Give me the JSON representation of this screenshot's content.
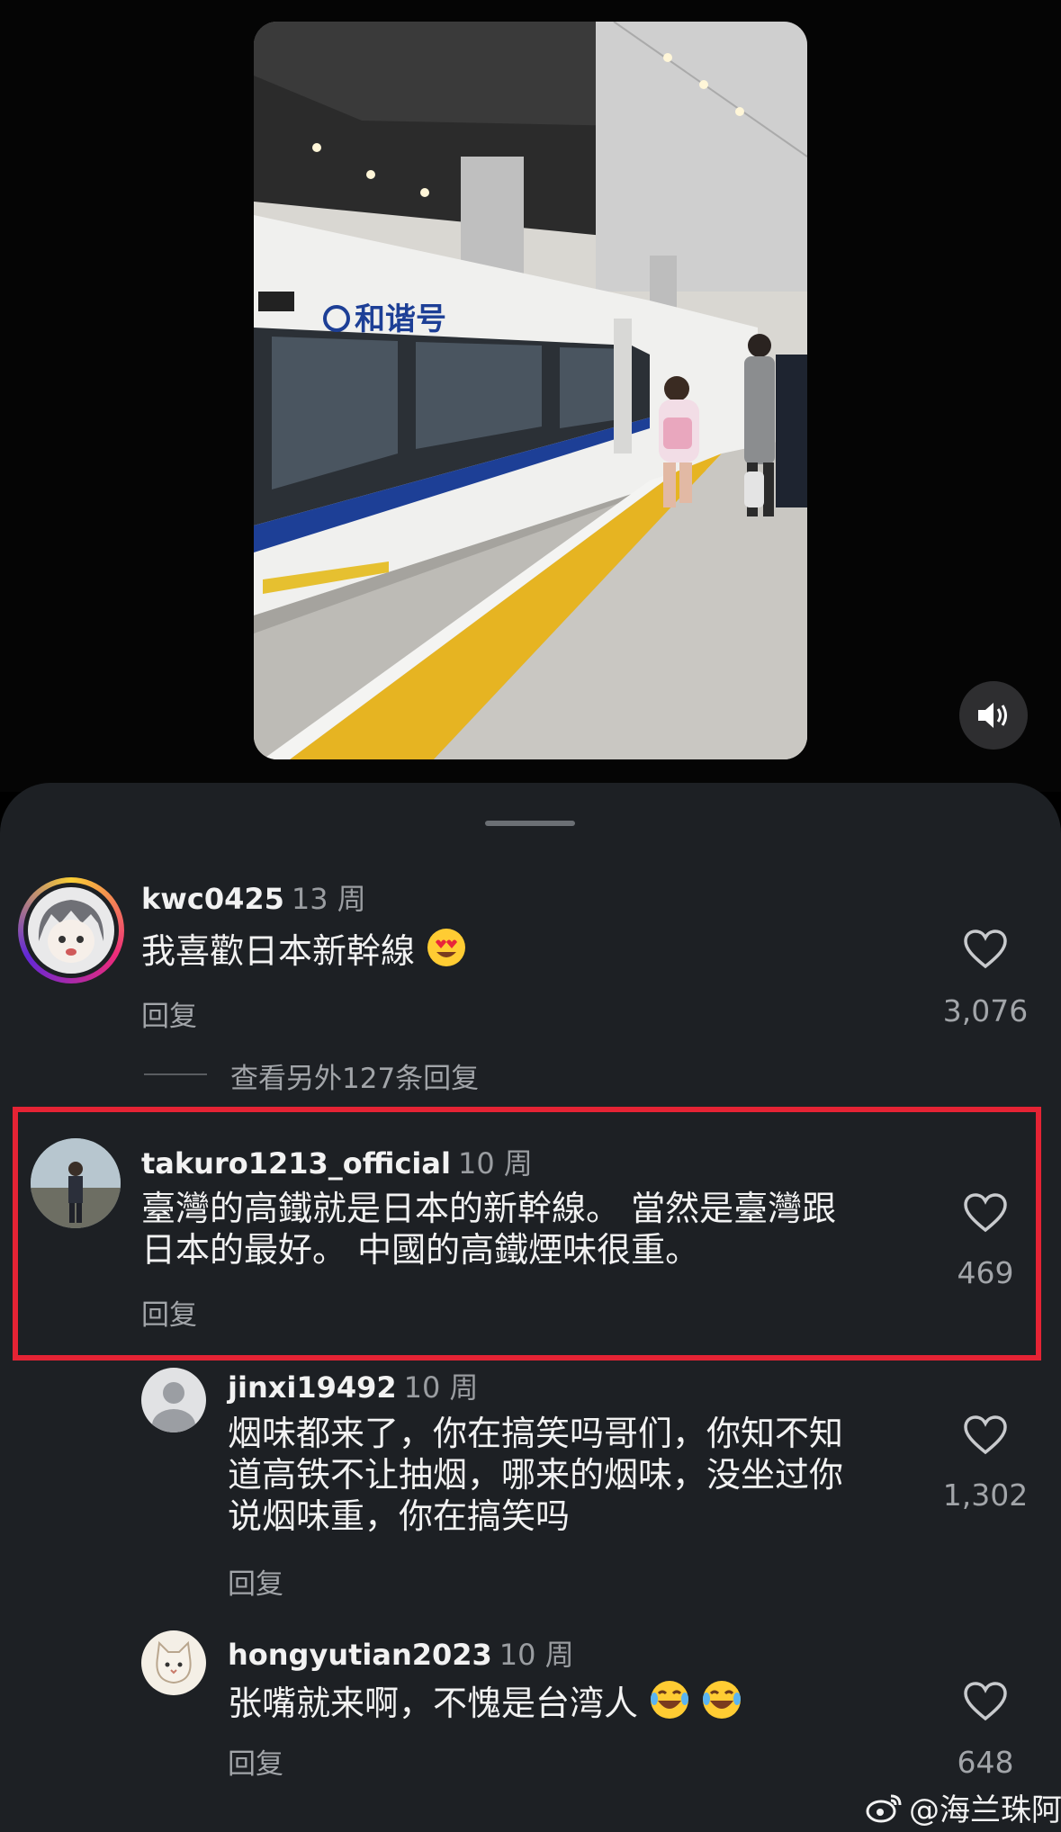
{
  "video": {
    "train_name": "和谐号",
    "sound_icon": "speaker-icon"
  },
  "comments": [
    {
      "username": "kwc0425",
      "age": "13 周",
      "text": "我喜歡日本新幹線",
      "emoji": "heart-eyes-emoji",
      "reply_label": "回复",
      "likes": "3,076"
    },
    {
      "username": "takuro1213_official",
      "age": "10 周",
      "text_line1": "臺灣的高鐵就是日本的新幹線。 當然是臺灣跟",
      "text_line2": "日本的最好。 中國的高鐵煙味很重。",
      "reply_label": "回复",
      "likes": "469"
    }
  ],
  "view_more_replies": "查看另外127条回复",
  "replies": [
    {
      "username": "jinxi19492",
      "age": "10 周",
      "text_line1": "烟味都来了，你在搞笑吗哥们，你知不知",
      "text_line2": "道高铁不让抽烟，哪来的烟味，没坐过你",
      "text_line3": "说烟味重，你在搞笑吗",
      "reply_label": "回复",
      "likes": "1,302"
    },
    {
      "username": "hongyutian2023",
      "age": "10 周",
      "text": "张嘴就来啊，不愧是台湾人",
      "emoji": "laughing-tears-emoji",
      "reply_label": "回复",
      "likes": "648"
    }
  ],
  "watermark": "@海兰珠阿婶",
  "colors": {
    "sheet_bg": "#1d2024",
    "highlight_border": "#e52334",
    "text_primary": "#f2f2f2",
    "text_secondary": "#a2a5a9"
  }
}
